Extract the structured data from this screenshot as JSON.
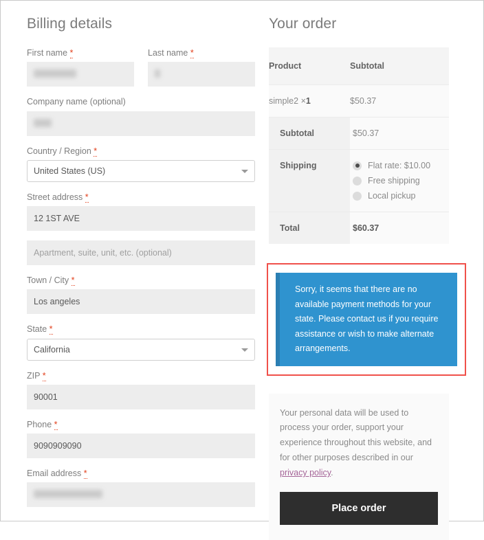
{
  "billing": {
    "title": "Billing details",
    "required_mark": "*",
    "fields": {
      "first_name": {
        "label": "First name",
        "required": true,
        "value": "",
        "redacted": true,
        "redacted_width": 62
      },
      "last_name": {
        "label": "Last name",
        "required": true,
        "value": "",
        "redacted": true,
        "redacted_width": 8
      },
      "company": {
        "label": "Company name (optional)",
        "required": false,
        "value": "",
        "redacted": true,
        "redacted_width": 26
      },
      "country": {
        "label": "Country / Region",
        "required": true,
        "value": "United States (US)"
      },
      "street": {
        "label": "Street address",
        "required": true,
        "value": "12 1ST AVE"
      },
      "address2": {
        "label": "",
        "required": false,
        "value": "",
        "placeholder": "Apartment, suite, unit, etc. (optional)"
      },
      "city": {
        "label": "Town / City",
        "required": true,
        "value": "Los angeles"
      },
      "state": {
        "label": "State",
        "required": true,
        "value": "California"
      },
      "zip": {
        "label": "ZIP",
        "required": true,
        "value": "90001"
      },
      "phone": {
        "label": "Phone",
        "required": true,
        "value": "9090909090"
      },
      "email": {
        "label": "Email address",
        "required": true,
        "value": "",
        "redacted": true,
        "redacted_width": 100
      }
    }
  },
  "order": {
    "title": "Your order",
    "columns": {
      "product": "Product",
      "subtotal": "Subtotal"
    },
    "items": [
      {
        "name": "simple2",
        "qty_sep": "×",
        "qty": "1",
        "subtotal": "$50.37"
      }
    ],
    "subtotal_label": "Subtotal",
    "subtotal_value": "$50.37",
    "shipping_label": "Shipping",
    "shipping_options": [
      {
        "label": "Flat rate: $10.00",
        "selected": true
      },
      {
        "label": "Free shipping",
        "selected": false
      },
      {
        "label": "Local pickup",
        "selected": false
      }
    ],
    "total_label": "Total",
    "total_value": "$60.37"
  },
  "notice": {
    "message": "Sorry, it seems that there are no available payment methods for your state. Please contact us if you require assistance or wish to make alternate arrangements.",
    "background_color": "#2f93cf",
    "accent_color": "#2b7fb3",
    "annotation_color": "#f0504a"
  },
  "privacy": {
    "text_before": "Your personal data will be used to process your order, support your experience throughout this website, and for other purposes described in our ",
    "link_label": "privacy policy",
    "text_after": ".",
    "link_color": "#a46497"
  },
  "place_order": {
    "label": "Place order",
    "background_color": "#2e2e2e"
  }
}
